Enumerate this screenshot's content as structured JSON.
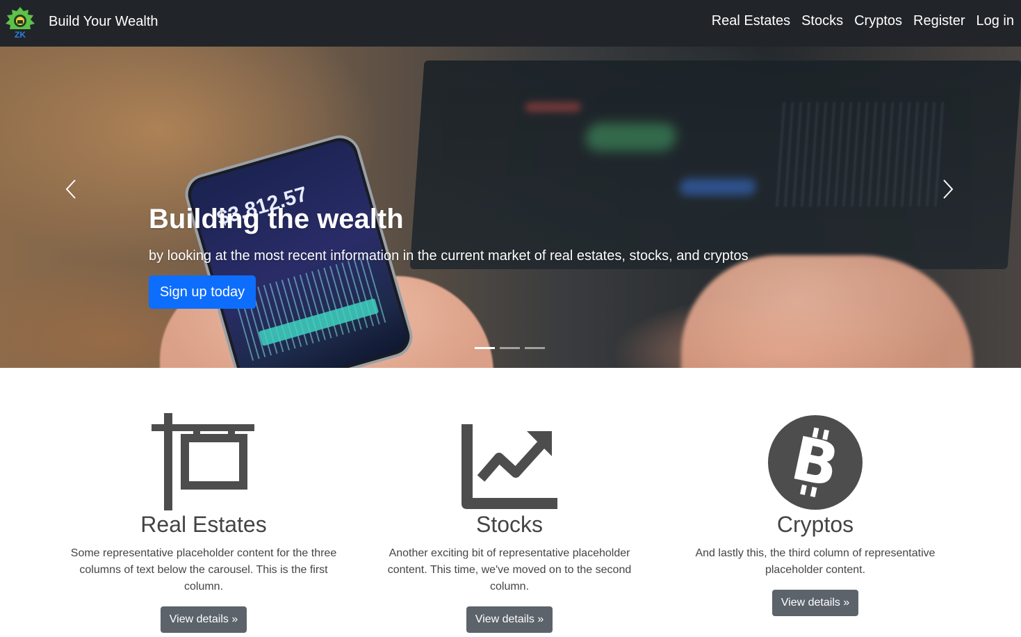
{
  "nav": {
    "brand": "Build Your Wealth",
    "logo_text": "ZK",
    "links": [
      "Real Estates",
      "Stocks",
      "Cryptos",
      "Register",
      "Log in"
    ]
  },
  "hero": {
    "title": "Building the wealth",
    "subtitle": "by looking at the most recent information in the current market of real estates, stocks, and cryptos",
    "cta": "Sign up today",
    "phone_price": "$3,812.57",
    "active_slide": 1,
    "slide_count": 3
  },
  "features": [
    {
      "icon": "sign-icon",
      "title": "Real Estates",
      "text": "Some representative placeholder content for the three columns of text below the carousel. This is the first column.",
      "button": "View details »"
    },
    {
      "icon": "chart-line-icon",
      "title": "Stocks",
      "text": "Another exciting bit of representative placeholder content. This time, we've moved on to the second column.",
      "button": "View details »"
    },
    {
      "icon": "bitcoin-icon",
      "title": "Cryptos",
      "text": "And lastly this, the third column of representative placeholder content.",
      "button": "View details »"
    }
  ],
  "colors": {
    "navbar": "#212529",
    "primary": "#0d6efd",
    "secondary": "#5c636a",
    "icon": "#4d4d4d"
  }
}
